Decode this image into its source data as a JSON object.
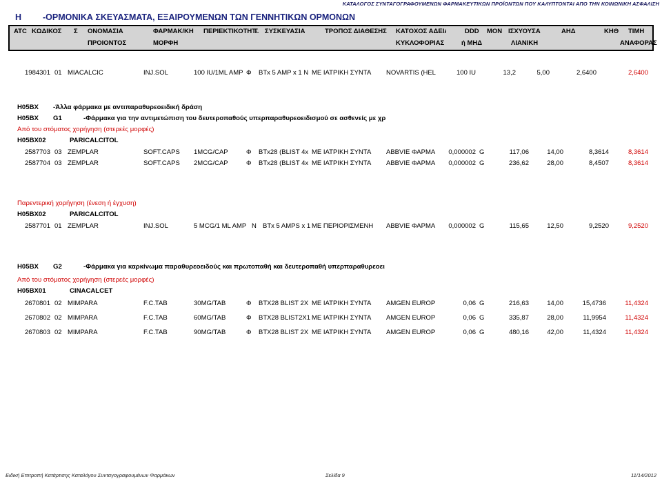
{
  "running_head": "ΚΑΤΑΛΟΓΟΣ ΣΥΝΤΑΓΟΓΡΑΦΟΥΜΕΝΩΝ ΦΑΡΜΑΚΕΥΤΙΚΩΝ ΠΡΟΪΟΝΤΩΝ ΠΟΥ ΚΑΛΥΠΤΟΝΤΑΙ ΑΠΟ ΤΗΝ ΚΟΙΝΩΝΙΚΗ ΑΣΦΑΛΙΣΗ",
  "category": {
    "code": "H",
    "title": "-ΟΡΜΟΝΙΚΑ ΣΚΕΥΑΣΜΑΤΑ, ΕΞΑΙΡΟΥΜΕΝΩΝ ΤΩΝ ΓΕΝΝΗΤΙΚΩΝ ΟΡΜΟΝΩΝ"
  },
  "table_header": {
    "line1": [
      "ATC",
      "ΚΩΔΙΚΟΣ",
      "Σ",
      "ΟΝΟΜΑΣΙΑ",
      "ΦΑΡΜΑΚ/ΚΗ",
      "ΠΕΡΙΕΚΤΙΚΟΤΗΤΑ",
      "Τ.",
      "ΣΥΣΚΕΥΑΣΙΑ",
      "ΤΡΟΠΟΣ ΔΙΑΘΕΣΗΣ",
      "ΚΑΤΟΧΟΣ ΑΔΕΙΑΣ",
      "DDD",
      "ΜΟΝ",
      "ΙΣΧΥΟΥΣΑ",
      "ΑΗΔ",
      "ΚΗΘ",
      "ΤΙΜΗ"
    ],
    "line2": [
      "ΠΡΟΙΟΝΤΟΣ",
      "ΜΟΡΦΗ",
      "ΚΥΚΛΟΦΟΡΙΑΣ",
      "ή ΜΗΔ",
      "ΛΙΑΝΙΚΗ",
      "ΑΝΑΦΟΡΑΣ"
    ]
  },
  "top_row": {
    "code": "1984301",
    "s": "01",
    "name": "MIACALCIC",
    "form": "INJ.SOL",
    "strength": "100 IU/1ML AMP",
    "t": "Φ",
    "package": "BTx 5 AMP x 1 N",
    "supply": "ΜΕ ΙΑΤΡΙΚΗ ΣΥΝΤΑ",
    "holder": "NOVARTIS (HEL",
    "ddd": "100 IU",
    "mon": "13,2",
    "retail": "5,00",
    "ahd": "2,6400",
    "ref": "2,6400"
  },
  "groups": [
    {
      "code": "H05BX",
      "sub": "",
      "title": "-Άλλα φάρμακα με αντιπαραθυρεοειδική δράση"
    },
    {
      "code": "H05BX",
      "sub": "G1",
      "title": "-Φάρμακα για την αντιμετώπιση του δευτεροπαθούς υπερπαραθυρεοειδισμού σε ασθενείς με χρ"
    },
    {
      "code": "H05BX",
      "sub": "G2",
      "title": "-Φάρμακα για καρκίνωμα παραθυρεοειδούς και πρωτοπαθή και δευτεροπαθή υπερπαραθυρεοει"
    }
  ],
  "routes": {
    "oral_solid": "Από του στόματος χορήγηση (στερεές μορφές)",
    "parenteral": "Παρεντερική χορήγηση (ένεση ή έγχυση)"
  },
  "substances": {
    "paricalcitol": {
      "code": "H05BX02",
      "name": "PARICALCITOL"
    },
    "cinacalcet": {
      "code": "H05BX01",
      "name": "CINACALCET"
    }
  },
  "block_oral_paricalcitol": [
    {
      "code": "2587703",
      "s": "03",
      "name": "ZEMPLAR",
      "form": "SOFT.CAPS",
      "strength": "1MCG/CAP",
      "t": "Φ",
      "package": "BTx28 (BLIST 4x",
      "supply": "ΜΕ ΙΑΤΡΙΚΗ ΣΥΝΤΑ",
      "holder": "ABBVIE ΦΑΡΜΑ",
      "ddd": "0,000002",
      "mon": "G",
      "retail": "117,06",
      "ahd": "14,00",
      "kth": "8,3614",
      "ref": "8,3614"
    },
    {
      "code": "2587704",
      "s": "03",
      "name": "ZEMPLAR",
      "form": "SOFT.CAPS",
      "strength": "2MCG/CAP",
      "t": "Φ",
      "package": "BTx28 (BLIST 4x",
      "supply": "ΜΕ ΙΑΤΡΙΚΗ ΣΥΝΤΑ",
      "holder": "ABBVIE ΦΑΡΜΑ",
      "ddd": "0,000002",
      "mon": "G",
      "retail": "236,62",
      "ahd": "28,00",
      "kth": "8,4507",
      "ref": "8,3614"
    }
  ],
  "block_parenteral_paricalcitol": [
    {
      "code": "2587701",
      "s": "01",
      "name": "ZEMPLAR",
      "form": "INJ.SOL",
      "strength": "5 MCG/1 ML AMP",
      "t": "N",
      "package": "BTx 5 AMPS x 1",
      "supply": "ΜΕ ΠΕΡΙΟΡΙΣΜΕΝΗ",
      "holder": "ABBVIE ΦΑΡΜΑ",
      "ddd": "0,000002",
      "mon": "G",
      "retail": "115,65",
      "ahd": "12,50",
      "kth": "9,2520",
      "ref": "9,2520"
    }
  ],
  "block_oral_cinacalcet": [
    {
      "code": "2670801",
      "s": "02",
      "name": "MIMPARA",
      "form": "F.C.TAB",
      "strength": "30MG/TAB",
      "t": "Φ",
      "package": "BTX28 BLIST 2X",
      "supply": "ΜΕ ΙΑΤΡΙΚΗ ΣΥΝΤΑ",
      "holder": "AMGEN EUROP",
      "ddd": "0,06",
      "mon": "G",
      "retail": "216,63",
      "ahd": "14,00",
      "kth": "15,4736",
      "ref": "11,4324"
    },
    {
      "code": "2670802",
      "s": "02",
      "name": "MIMPARA",
      "form": "F.C.TAB",
      "strength": "60MG/TAB",
      "t": "Φ",
      "package": "BTX28 BLIST2X1",
      "supply": "ΜΕ ΙΑΤΡΙΚΗ ΣΥΝΤΑ",
      "holder": "AMGEN EUROP",
      "ddd": "0,06",
      "mon": "G",
      "retail": "335,87",
      "ahd": "28,00",
      "kth": "11,9954",
      "ref": "11,4324"
    },
    {
      "code": "2670803",
      "s": "02",
      "name": "MIMPARA",
      "form": "F.C.TAB",
      "strength": "90MG/TAB",
      "t": "Φ",
      "package": "BTX28 BLIST 2X",
      "supply": "ΜΕ ΙΑΤΡΙΚΗ ΣΥΝΤΑ",
      "holder": "AMGEN EUROP",
      "ddd": "0,06",
      "mon": "G",
      "retail": "480,16",
      "ahd": "42,00",
      "kth": "11,4324",
      "ref": "11,4324"
    }
  ],
  "footer": {
    "left": "Ειδική Επιτροπή Κατάρτισης Καταλόγου Συνταγογραφουμένων Φαρμάκων",
    "page": "Σελίδα 9",
    "date": "11/14/2012"
  }
}
